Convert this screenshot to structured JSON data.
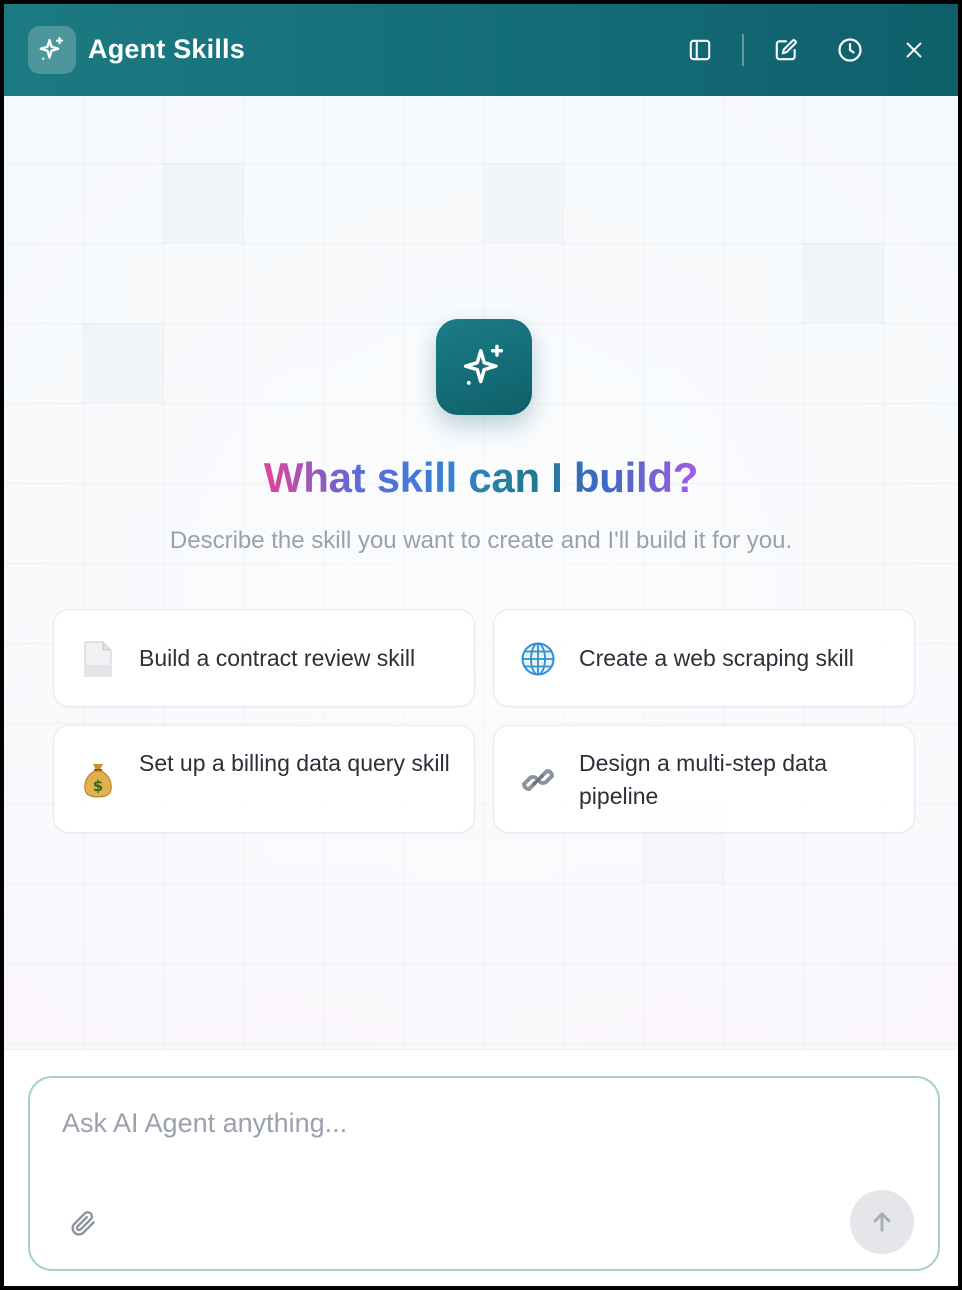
{
  "header": {
    "title": "Agent Skills",
    "logo_icon": "sparkle-icon",
    "actions": [
      {
        "name": "toggle-sidebar-button",
        "icon": "sidebar-icon"
      },
      {
        "name": "new-chat-button",
        "icon": "edit-icon"
      },
      {
        "name": "history-button",
        "icon": "clock-icon"
      },
      {
        "name": "close-button",
        "icon": "close-icon"
      }
    ]
  },
  "hero": {
    "icon": "sparkle-icon",
    "headline": "What skill can I build?",
    "subtitle": "Describe the skill you want to create and I'll build it for you."
  },
  "suggestions": [
    {
      "emoji": "📄",
      "icon": "document-icon",
      "label": "Build a contract review skill"
    },
    {
      "emoji": "🌐",
      "icon": "globe-icon",
      "label": "Create a web scraping skill"
    },
    {
      "emoji": "💰",
      "icon": "money-bag-icon",
      "label": "Set up a billing data query skill"
    },
    {
      "emoji": "🔗",
      "icon": "link-icon",
      "label": "Design a multi-step data pipeline"
    }
  ],
  "composer": {
    "placeholder": "Ask AI Agent anything...",
    "value": "",
    "attach_icon": "paperclip-icon",
    "send_icon": "arrow-up-icon"
  },
  "colors": {
    "header_start": "#1c7a82",
    "header_end": "#0f5f6b",
    "accent": "#146d78",
    "composer_border": "#a9cfd3"
  }
}
